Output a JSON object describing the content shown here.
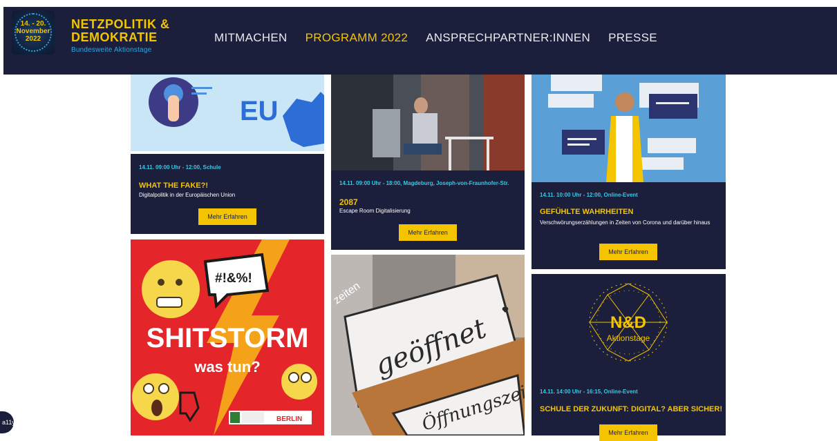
{
  "logo": {
    "date_line1": "14. - 20.",
    "date_line2": "November",
    "date_line3": "2022",
    "title_line1": "NETZPOLITIK &",
    "title_line2": "DEMOKRATIE",
    "subtitle": "Bundesweite Aktionstage"
  },
  "nav": {
    "items": [
      "MITMACHEN",
      "PROGRAMM 2022",
      "ANSPRECHPARTNER:INNEN",
      "PRESSE"
    ],
    "active_index": 1
  },
  "colors": {
    "navy": "#1c1f3c",
    "accent_yellow": "#f4c400",
    "meta_cyan": "#3cc7e0",
    "shitstorm_red": "#e4262b"
  },
  "cards": [
    {
      "meta": "14.11. 09:00 Uhr - 12:00,  Schule",
      "title": "WHAT THE FAKE?!",
      "desc": "Digitalpolitik in der Europäischen Union",
      "button": "Mehr Erfahren",
      "image_text": "EU"
    },
    {
      "meta": "14.11. 09:00 Uhr - 18:00,  Magdeburg,  Joseph-von-Fraunhofer-Str.",
      "title": "2087",
      "desc": "Escape Room Digitalisierung",
      "button": "Mehr Erfahren"
    },
    {
      "meta": "14.11. 10:00 Uhr - 12:00,  Online-Event",
      "title": "GEFÜHLTE WAHRHEITEN",
      "desc": "Verschwörungserzählungen in Zeiten von Corona und darüber hinaus",
      "button": "Mehr Erfahren"
    },
    {
      "image_text_1": "SHITSTORM",
      "image_text_2": "was tun?",
      "image_bubble": "#!&%!",
      "image_badge": "BERLIN"
    },
    {
      "image_text_1": "geöffnet",
      "image_text_2": "Öffnungszeiten",
      "image_text_3": "zeiten"
    },
    {
      "logo_line1": "N&D",
      "logo_line2": "Aktionstage",
      "meta": "14.11. 14:00 Uhr - 16:15,  Online-Event",
      "title": "SCHULE DER ZUKUNFT: DIGITAL? ABER SICHER!",
      "button": "Mehr Erfahren"
    }
  ],
  "a11y_label": "a11y"
}
